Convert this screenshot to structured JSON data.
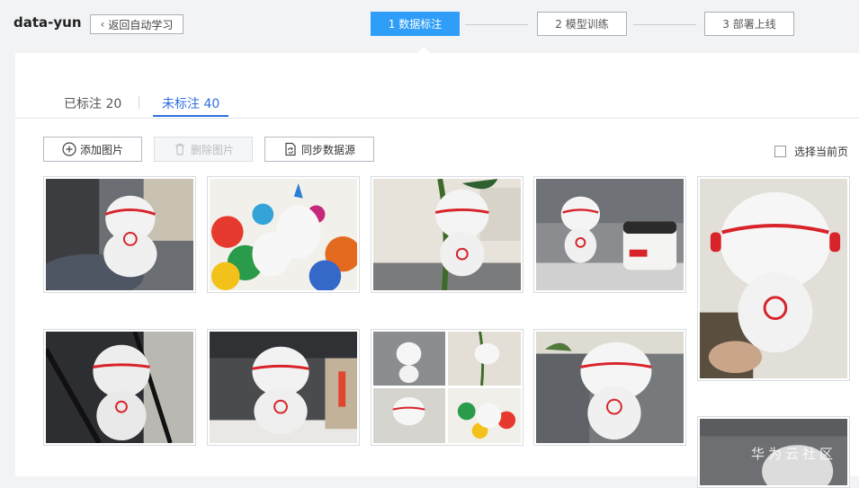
{
  "app": {
    "title": "data-yun"
  },
  "header": {
    "back_label": "返回自动学习",
    "steps": [
      {
        "label": "1 数据标注",
        "active": true
      },
      {
        "label": "2 模型训练",
        "active": false
      },
      {
        "label": "3 部署上线",
        "active": false
      }
    ]
  },
  "tabs": [
    {
      "label": "已标注 20",
      "active": false
    },
    {
      "label": "未标注 40",
      "active": true
    }
  ],
  "toolbar": {
    "add_label": "添加图片",
    "delete_label": "删除图片",
    "sync_label": "同步数据源",
    "select_page_label": "选择当前页"
  },
  "images": [
    {
      "scene": "office desk, plush toy back view"
    },
    {
      "scene": "plush toy with colorful pinwheels"
    },
    {
      "scene": "plush toy with green plant"
    },
    {
      "scene": "plush toy beside rice cooker"
    },
    {
      "scene": "plush toy held in hand"
    },
    {
      "scene": "plush toy near chair"
    },
    {
      "scene": "plush toy on cluttered desk"
    },
    {
      "scene": "collage of plush toy photos"
    },
    {
      "scene": "plush toy by partition wall"
    },
    {
      "scene": "plush toy partial view"
    }
  ],
  "watermark": "华为云社区",
  "colors": {
    "accent": "#2f9ef8",
    "tab_active": "#2f6fe0",
    "toy_red": "#d8232a"
  }
}
